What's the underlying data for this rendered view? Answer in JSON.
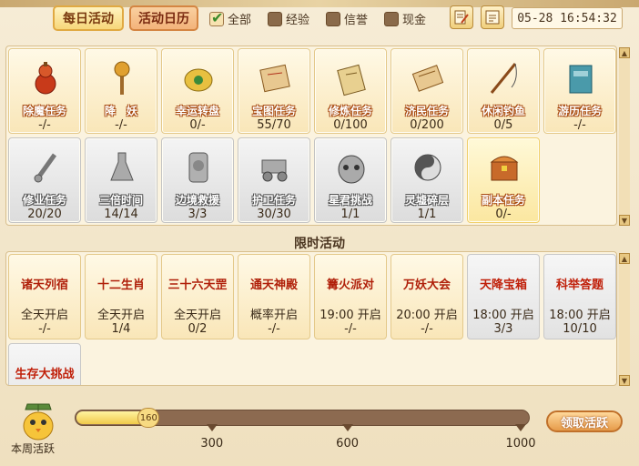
{
  "header": {
    "tab_daily": "每日活动",
    "tab_calendar": "活动日历",
    "filters": [
      {
        "label": "全部",
        "checked": true
      },
      {
        "label": "经验",
        "checked": false
      },
      {
        "label": "信誉",
        "checked": false
      },
      {
        "label": "现金",
        "checked": false
      }
    ],
    "clock": "05-28 16:54:32"
  },
  "daily": [
    {
      "name": "除魔任务",
      "value": "-/-",
      "style": "normal",
      "icon": "gourd-icon"
    },
    {
      "name": "降　妖",
      "value": "-/-",
      "style": "normal",
      "icon": "mace-icon"
    },
    {
      "name": "幸运转盘",
      "value": "0/-",
      "style": "normal",
      "icon": "wheel-icon"
    },
    {
      "name": "宝图任务",
      "value": "55/70",
      "style": "normal",
      "icon": "treasure-map-icon"
    },
    {
      "name": "修炼任务",
      "value": "0/100",
      "style": "normal",
      "icon": "book-icon"
    },
    {
      "name": "济民任务",
      "value": "0/200",
      "style": "normal",
      "icon": "scroll-icon"
    },
    {
      "name": "休闲钓鱼",
      "value": "0/5",
      "style": "normal",
      "icon": "fishing-rod-icon"
    },
    {
      "name": "游历任务",
      "value": "-/-",
      "style": "normal",
      "icon": "journal-icon"
    },
    {
      "name": "修业任务",
      "value": "20/20",
      "style": "gray",
      "icon": "sword-icon"
    },
    {
      "name": "三倍时间",
      "value": "14/14",
      "style": "gray",
      "icon": "flask-icon"
    },
    {
      "name": "边境救援",
      "value": "3/3",
      "style": "gray",
      "icon": "banner-icon"
    },
    {
      "name": "护卫任务",
      "value": "30/30",
      "style": "gray",
      "icon": "cart-icon"
    },
    {
      "name": "星君挑战",
      "value": "1/1",
      "style": "gray",
      "icon": "demon-mask-icon"
    },
    {
      "name": "灵墟碎层",
      "value": "1/1",
      "style": "gray",
      "icon": "yin-yang-icon"
    },
    {
      "name": "副本任务",
      "value": "0/-",
      "style": "highlight",
      "icon": "chest-icon"
    }
  ],
  "section_title": "限时活动",
  "limited": [
    {
      "name": "诸天列宿",
      "time": "全天开启",
      "value": "-/-",
      "style": "normal"
    },
    {
      "name": "十二生肖",
      "time": "全天开启",
      "value": "1/4",
      "style": "normal"
    },
    {
      "name": "三十六天罡",
      "time": "全天开启",
      "value": "0/2",
      "style": "normal"
    },
    {
      "name": "通天神殿",
      "time": "概率开启",
      "value": "-/-",
      "style": "normal"
    },
    {
      "name": "篝火派对",
      "time": "19:00 开启",
      "value": "-/-",
      "style": "normal"
    },
    {
      "name": "万妖大会",
      "time": "20:00 开启",
      "value": "-/-",
      "style": "normal"
    },
    {
      "name": "天降宝箱",
      "time": "18:00 开启",
      "value": "3/3",
      "style": "gray"
    },
    {
      "name": "科举答题",
      "time": "18:00 开启",
      "value": "10/10",
      "style": "gray"
    },
    {
      "name": "生存大挑战",
      "time": "",
      "value": "",
      "style": "gray"
    }
  ],
  "weekly": {
    "label": "本周活跃",
    "current": 160,
    "max": 1000,
    "milestones": [
      300,
      600,
      1000
    ],
    "claim_label": "领取活跃"
  }
}
